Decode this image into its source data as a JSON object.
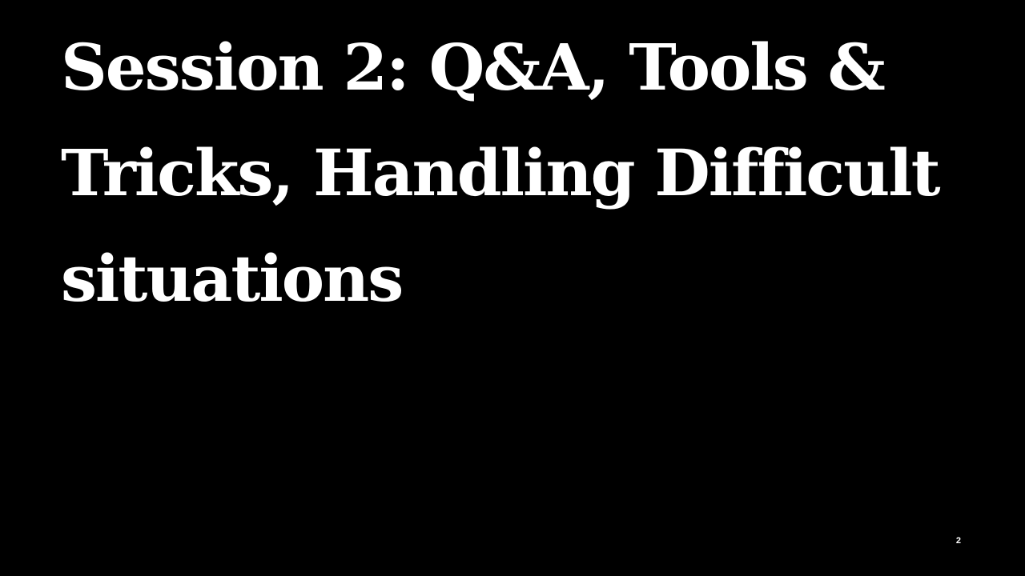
{
  "slide": {
    "title": "Session 2: Q&A, Tools & Tricks, Handling Difficult situations",
    "page_number": "2",
    "background_color": "#000000",
    "text_color": "#ffffff"
  }
}
